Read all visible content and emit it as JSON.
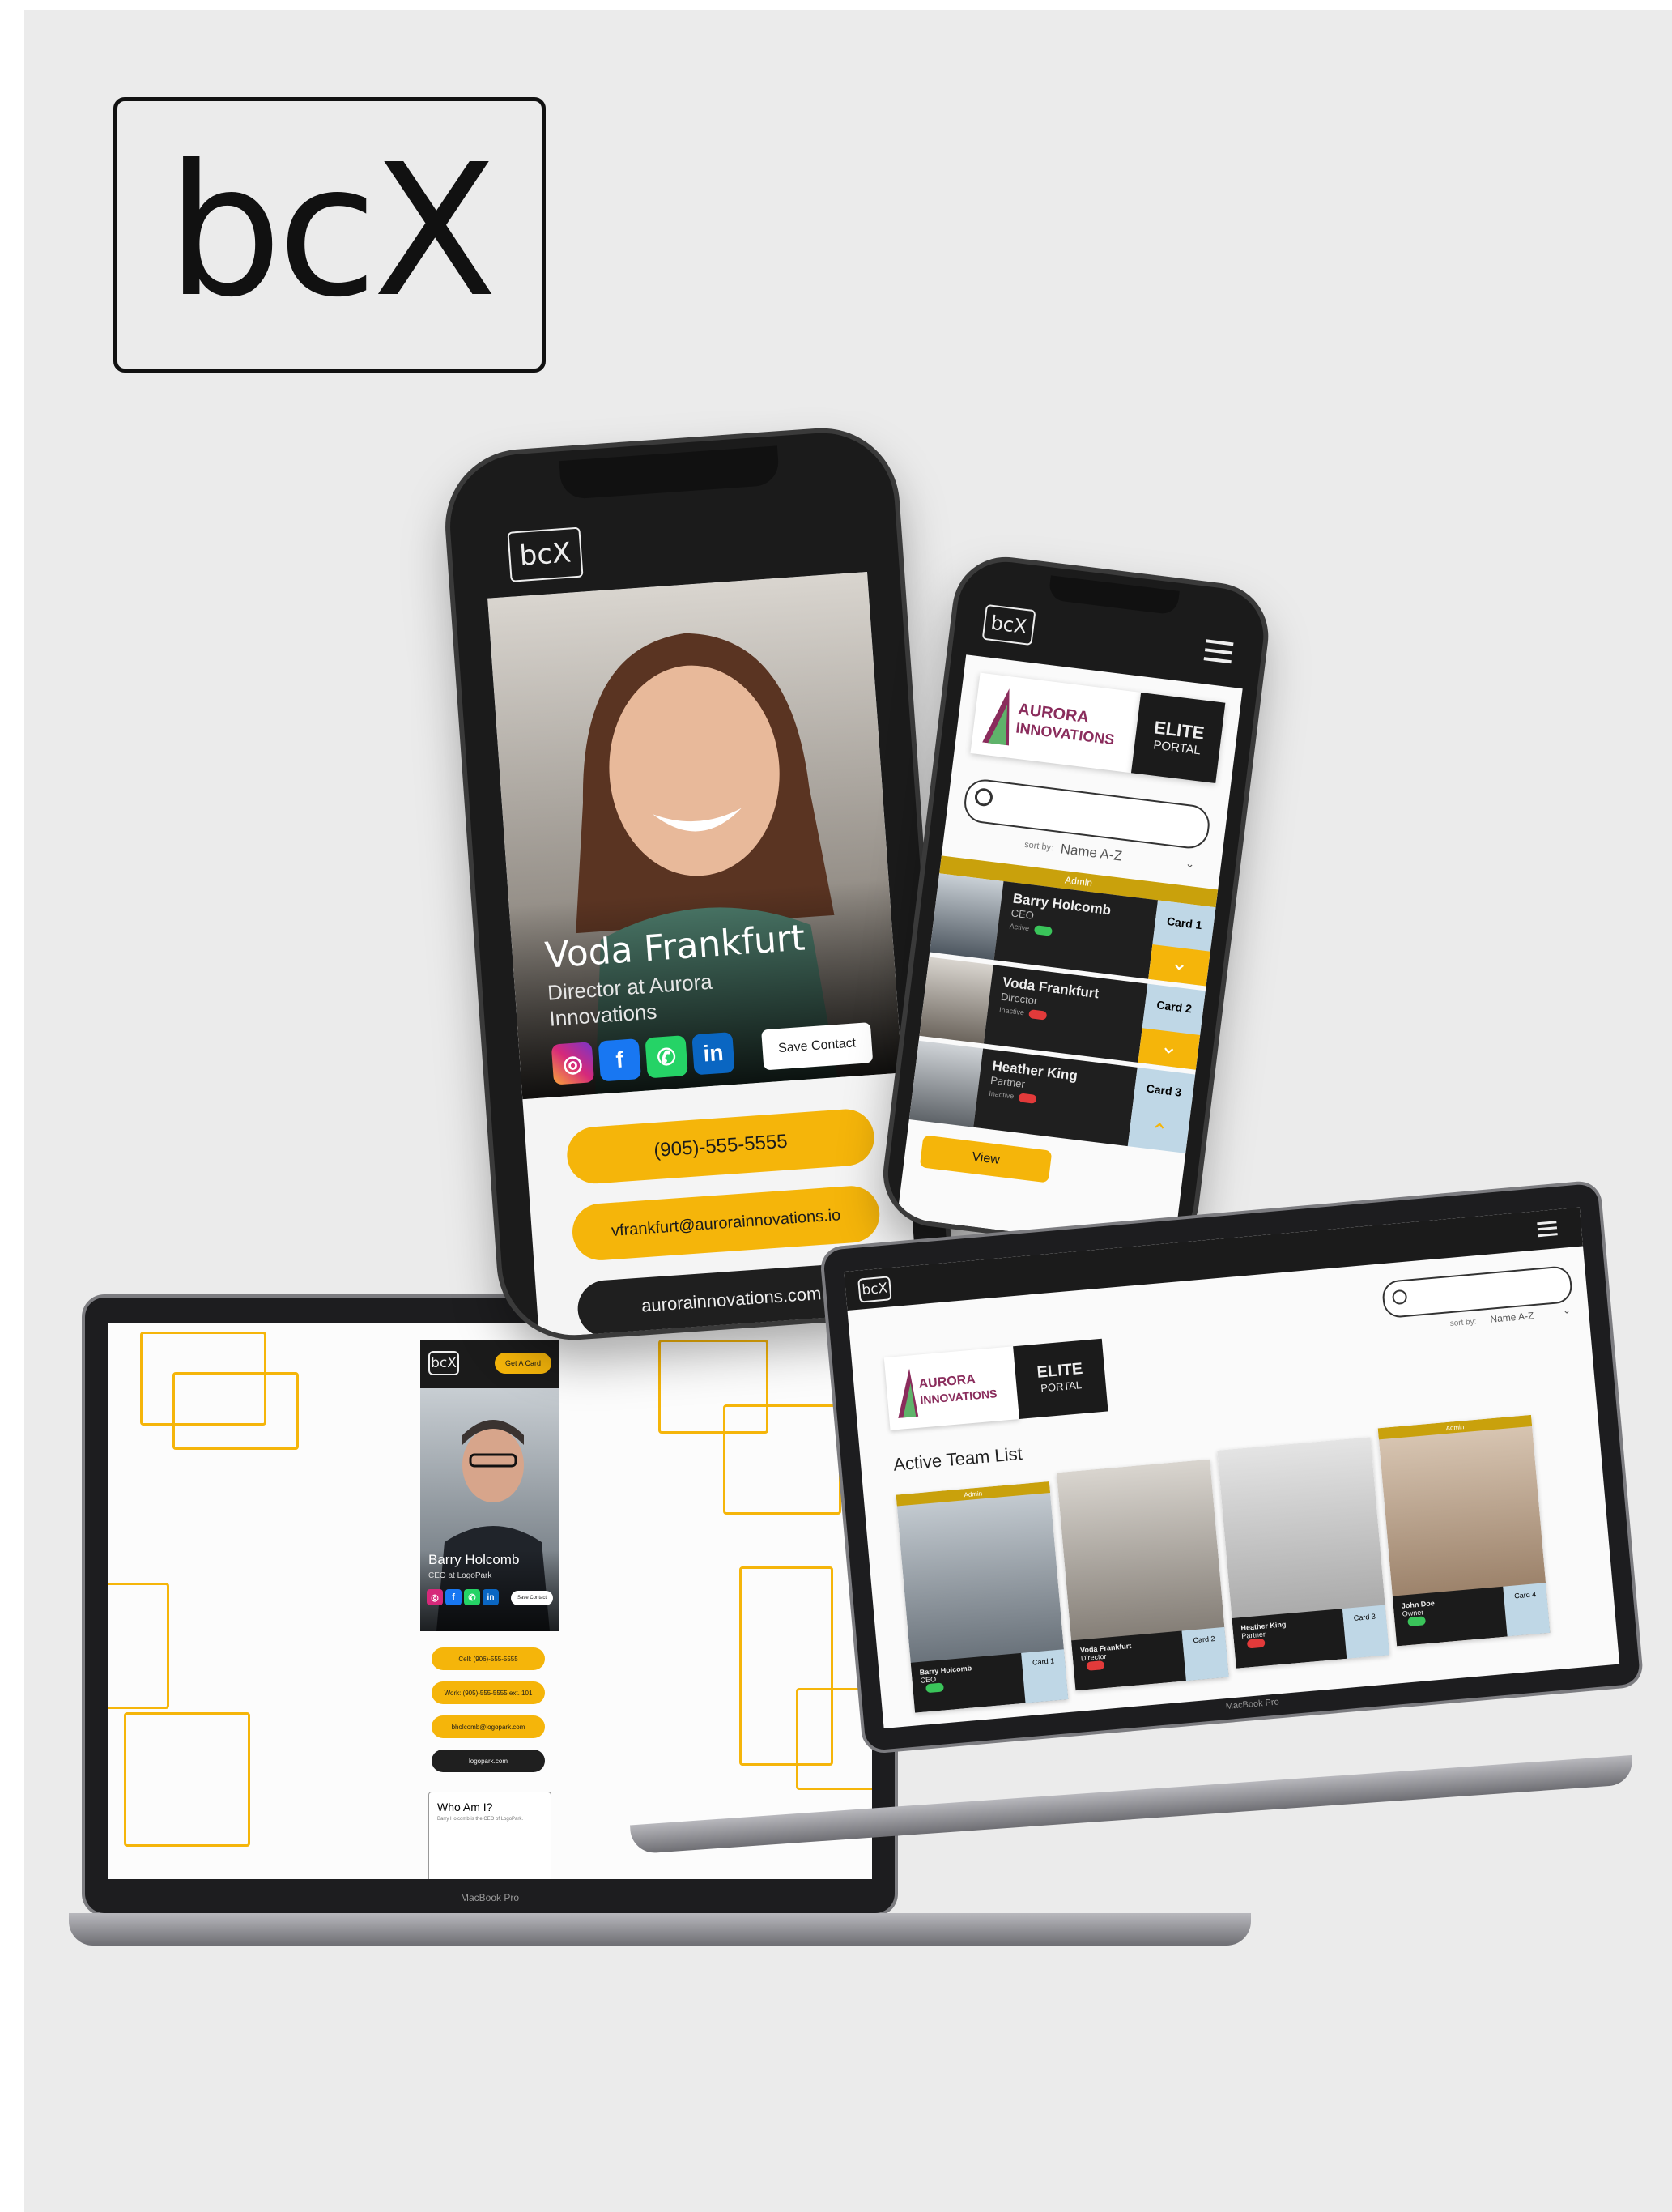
{
  "brand": {
    "logo_text": "bcX"
  },
  "phone_profile": {
    "logo_text": "bcX",
    "name": "Voda Frankfurt",
    "title": "Director at Aurora Innovations",
    "save_label": "Save Contact",
    "phone": "(905)-555-5555",
    "email": "vfrankfurt@aurorainnovations.io",
    "website": "aurorainnovations.com",
    "social_icons": [
      "instagram-icon",
      "facebook-icon",
      "whatsapp-icon",
      "linkedin-icon"
    ],
    "colors": {
      "accent": "#f5b50a",
      "dark": "#1f1f1f"
    }
  },
  "phone_portal": {
    "logo_text": "bcX",
    "company_line1": "AURORA",
    "company_line2": "INNOVATIONS",
    "portal_line1": "ELITE",
    "portal_line2": "PORTAL",
    "sort_label": "sort by:",
    "sort_value": "Name A-Z",
    "admin_badge": "Admin",
    "members": [
      {
        "name": "Barry Holcomb",
        "role": "CEO",
        "card": "Card 1",
        "status": "Active"
      },
      {
        "name": "Voda Frankfurt",
        "role": "Director",
        "card": "Card 2",
        "status": "Inactive"
      },
      {
        "name": "Heather King",
        "role": "Partner",
        "card": "Card 3",
        "status": "Inactive"
      }
    ],
    "view_label": "View"
  },
  "laptop_card": {
    "logo_text": "bcX",
    "cta": "Get A Card",
    "name": "Barry Holcomb",
    "title": "CEO at LogoPark",
    "save_label": "Save Contact",
    "cell": "Cell: (906)-555-5555",
    "work": "Work: (905)-555-5555 ext. 101",
    "email": "bholcomb@logopark.com",
    "website": "logopark.com",
    "about_title": "Who Am I?",
    "about_text": "Barry Holcomb is the CEO of LogoPark.",
    "model": "MacBook Pro"
  },
  "laptop_portal": {
    "logo_text": "bcX",
    "company_line1": "AURORA",
    "company_line2": "INNOVATIONS",
    "portal_line1": "ELITE",
    "portal_line2": "PORTAL",
    "sort_label": "sort by:",
    "sort_value": "Name A-Z",
    "list_title": "Active Team List",
    "admin_badge": "Admin",
    "members": [
      {
        "name": "Barry Holcomb",
        "role": "CEO",
        "card": "Card 1"
      },
      {
        "name": "Voda Frankfurt",
        "role": "Director",
        "card": "Card 2"
      },
      {
        "name": "Heather King",
        "role": "Partner",
        "card": "Card 3"
      },
      {
        "name": "John Doe",
        "role": "Owner",
        "card": "Card 4"
      }
    ],
    "model": "MacBook Pro"
  }
}
